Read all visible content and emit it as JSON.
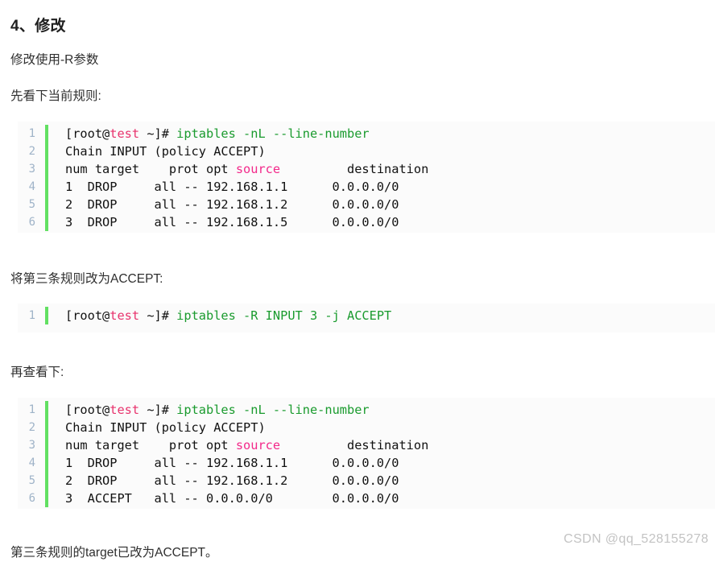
{
  "document": {
    "heading": "4、修改",
    "paragraphs": [
      "修改使用-R参数",
      "先看下当前规则:",
      "将第三条规则改为ACCEPT:",
      "再查看下:",
      "第三条规则的target已改为ACCEPT。"
    ],
    "watermark": "CSDN @qq_528155278"
  },
  "colors": {
    "code_background": "#fbfbfb",
    "gutter_bar": "#62e062",
    "line_number": "#9fb3c8",
    "token_host": "#e8336d",
    "token_command": "#1a9b2e",
    "token_keyword": "#f3298a",
    "code_foreground": "#111111",
    "watermark": "#c3c3c3"
  },
  "code_blocks": [
    {
      "id": "iptables-list-before",
      "lines": [
        {
          "number": "1",
          "segments": [
            {
              "text": "[root@",
              "token": "plain"
            },
            {
              "text": "test",
              "token": "host"
            },
            {
              "text": " ~]# ",
              "token": "plain"
            },
            {
              "text": "iptables -nL --line-number",
              "token": "command"
            }
          ]
        },
        {
          "number": "2",
          "segments": [
            {
              "text": "Chain INPUT (policy ACCEPT)",
              "token": "plain"
            }
          ]
        },
        {
          "number": "3",
          "segments": [
            {
              "text": "num target    prot opt ",
              "token": "plain"
            },
            {
              "text": "source",
              "token": "keyword"
            },
            {
              "text": "         destination",
              "token": "plain"
            }
          ]
        },
        {
          "number": "4",
          "segments": [
            {
              "text": "1  DROP     all -- 192.168.1.1      0.0.0.0/0",
              "token": "plain"
            }
          ]
        },
        {
          "number": "5",
          "segments": [
            {
              "text": "2  DROP     all -- 192.168.1.2      0.0.0.0/0",
              "token": "plain"
            }
          ]
        },
        {
          "number": "6",
          "segments": [
            {
              "text": "3  DROP     all -- 192.168.1.5      0.0.0.0/0",
              "token": "plain"
            }
          ]
        }
      ]
    },
    {
      "id": "iptables-replace-rule",
      "lines": [
        {
          "number": "1",
          "segments": [
            {
              "text": "[root@",
              "token": "plain"
            },
            {
              "text": "test",
              "token": "host"
            },
            {
              "text": " ~]# ",
              "token": "plain"
            },
            {
              "text": "iptables -R INPUT 3 -j ACCEPT",
              "token": "command"
            }
          ]
        }
      ]
    },
    {
      "id": "iptables-list-after",
      "lines": [
        {
          "number": "1",
          "segments": [
            {
              "text": "[root@",
              "token": "plain"
            },
            {
              "text": "test",
              "token": "host"
            },
            {
              "text": " ~]# ",
              "token": "plain"
            },
            {
              "text": "iptables -nL --line-number",
              "token": "command"
            }
          ]
        },
        {
          "number": "2",
          "segments": [
            {
              "text": "Chain INPUT (policy ACCEPT)",
              "token": "plain"
            }
          ]
        },
        {
          "number": "3",
          "segments": [
            {
              "text": "num target    prot opt ",
              "token": "plain"
            },
            {
              "text": "source",
              "token": "keyword"
            },
            {
              "text": "         destination",
              "token": "plain"
            }
          ]
        },
        {
          "number": "4",
          "segments": [
            {
              "text": "1  DROP     all -- 192.168.1.1      0.0.0.0/0",
              "token": "plain"
            }
          ]
        },
        {
          "number": "5",
          "segments": [
            {
              "text": "2  DROP     all -- 192.168.1.2      0.0.0.0/0",
              "token": "plain"
            }
          ]
        },
        {
          "number": "6",
          "segments": [
            {
              "text": "3  ACCEPT   all -- 0.0.0.0/0        0.0.0.0/0",
              "token": "plain"
            }
          ]
        }
      ]
    }
  ]
}
